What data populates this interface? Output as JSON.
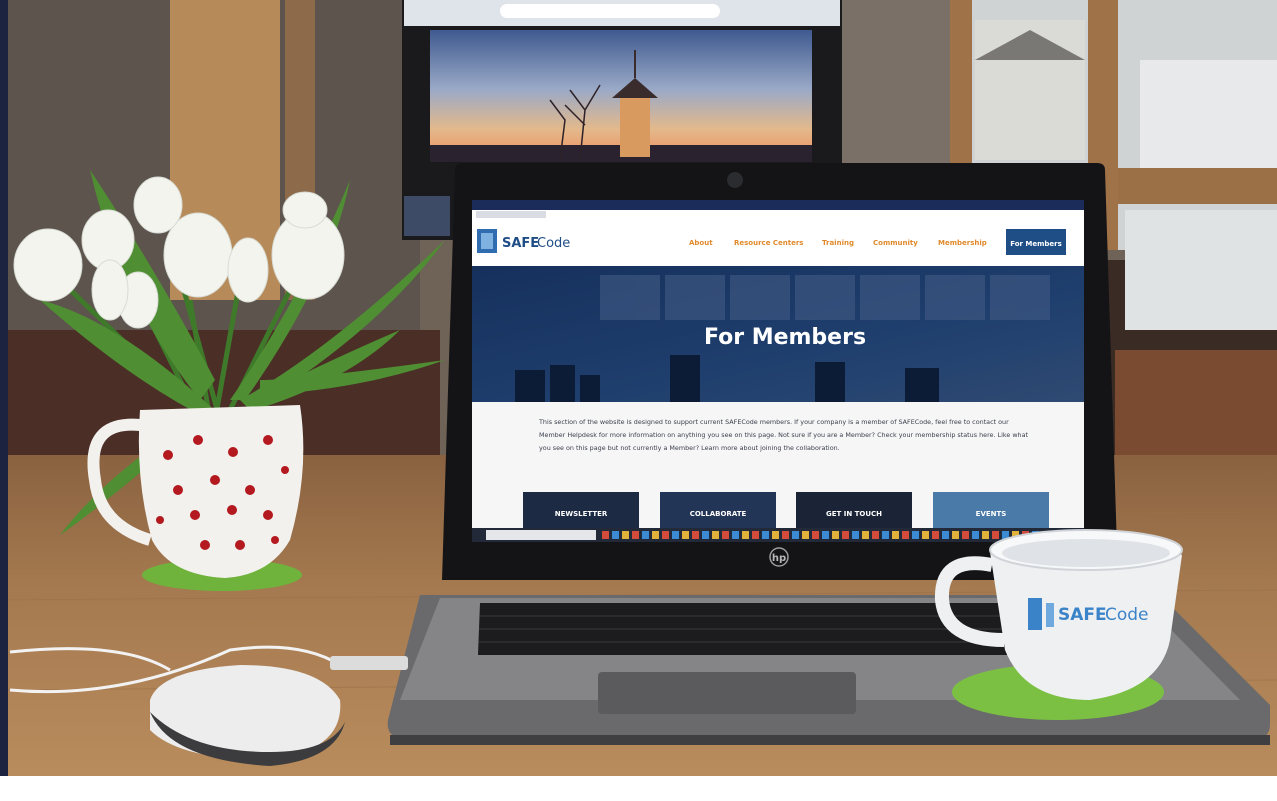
{
  "site": {
    "logo_text_safe": "SAFE",
    "logo_text_code": "Code",
    "nav": [
      "About",
      "Resource Centers",
      "Training",
      "Community",
      "Membership"
    ],
    "nav_active": "For Members",
    "hero_title": "For Members",
    "intro": "This section of the website is designed to support current SAFECode members. If your company is a member of SAFECode, feel free to contact our Member Helpdesk for more information on anything you see on this page. Not sure if you are a Member? Check your membership status here. Like what you see on this page but not currently a Member? Learn more about joining the collaboration.",
    "cards": [
      "NEWSLETTER",
      "COLLABORATE",
      "GET IN TOUCH",
      "EVENTS"
    ]
  },
  "laptop": {
    "brand": "hp"
  },
  "mug": {
    "logo_safe": "SAFE",
    "logo_code": "Code"
  },
  "colors": {
    "brand_blue": "#1f4e87",
    "nav_orange": "#e08a2c",
    "hero_navy": "#132c54",
    "felt_green": "#7bc043",
    "table_wood": "#a4794f"
  }
}
